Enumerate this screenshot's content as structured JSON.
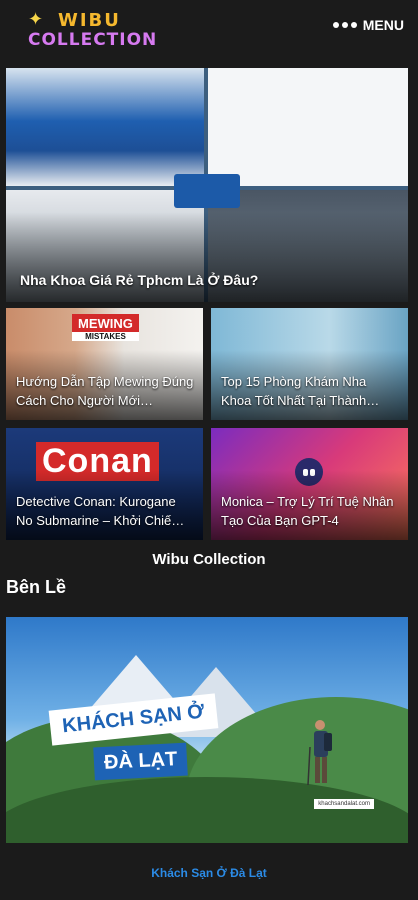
{
  "header": {
    "logo_line1": "WIBU",
    "logo_line2": "COLLECTION",
    "menu_label": "MENU"
  },
  "hero": {
    "title": "Nha Khoa Giá Rẻ Tphcm Là Ở Đâu?"
  },
  "cards": [
    {
      "title": "Hướng Dẫn Tập Mewing Đúng Cách Cho Người Mới…",
      "overlay": "MEWING",
      "overlay_sub": "MISTAKES"
    },
    {
      "title": "Top 15 Phòng Khám Nha Khoa Tốt Nhất Tại Thành…"
    },
    {
      "title": "Detective Conan: Kurogane No Submarine – Khởi Chiế…",
      "overlay": "Conan"
    },
    {
      "title": "Monica – Trợ Lý Trí Tuệ Nhân Tạo Của Bạn GPT-4"
    }
  ],
  "site_name": "Wibu Collection",
  "section_title": "Bên Lề",
  "banner": {
    "line1": "KHÁCH SẠN Ở",
    "line2": "ĐÀ LẠT",
    "site": "khachsandalat.com"
  },
  "banner_link": "Khách Sạn Ở Đà Lạt"
}
